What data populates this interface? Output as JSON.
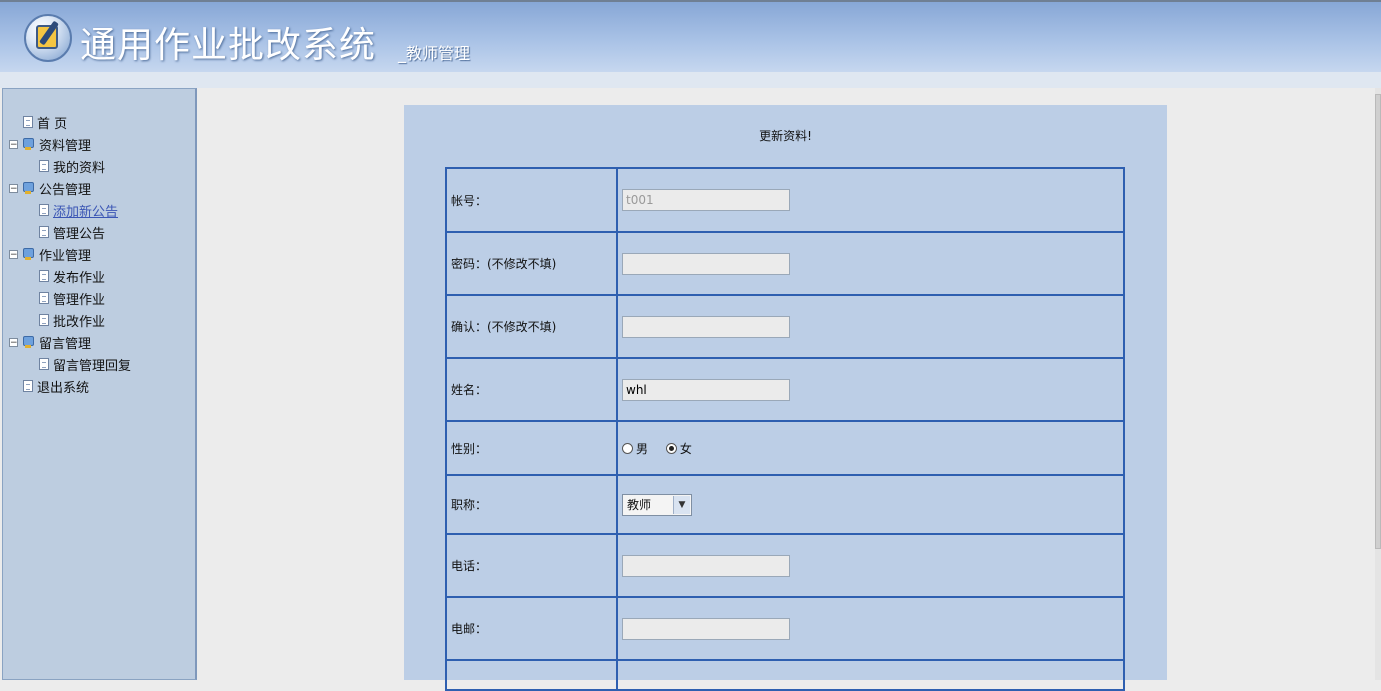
{
  "header": {
    "title": "通用作业批改系统",
    "subtitle": "_教师管理"
  },
  "sidebar": {
    "items": [
      {
        "label": "首  页",
        "level": 0,
        "icon": "page-icon"
      },
      {
        "label": "资料管理",
        "level": 1,
        "icon": "folder-icon",
        "expander": "⊟"
      },
      {
        "label": "我的资料",
        "level": 2,
        "icon": "page-icon"
      },
      {
        "label": "公告管理",
        "level": 1,
        "icon": "folder-icon",
        "expander": "⊟"
      },
      {
        "label": "添加新公告",
        "level": 2,
        "icon": "page-icon",
        "link": true
      },
      {
        "label": "管理公告",
        "level": 2,
        "icon": "page-icon"
      },
      {
        "label": "作业管理",
        "level": 1,
        "icon": "folder-icon",
        "expander": "⊟"
      },
      {
        "label": "发布作业",
        "level": 2,
        "icon": "page-icon"
      },
      {
        "label": "管理作业",
        "level": 2,
        "icon": "page-icon"
      },
      {
        "label": "批改作业",
        "level": 2,
        "icon": "page-icon"
      },
      {
        "label": "留言管理",
        "level": 1,
        "icon": "folder-icon",
        "expander": "⊟"
      },
      {
        "label": "留言管理回复",
        "level": 2,
        "icon": "page-icon"
      },
      {
        "label": "退出系统",
        "level": 0,
        "icon": "page-icon"
      }
    ]
  },
  "form": {
    "title": "更新资料!",
    "account": {
      "label": "帐号：",
      "value": "t001"
    },
    "password": {
      "label": "密码：(不修改不填)",
      "value": ""
    },
    "confirm": {
      "label": "确认：(不修改不填)",
      "value": ""
    },
    "name": {
      "label": "姓名：",
      "value": "whl"
    },
    "gender": {
      "label": "性别：",
      "options": [
        "男",
        "女"
      ],
      "selected": "女"
    },
    "title_field": {
      "label": "职称：",
      "value": "教师"
    },
    "phone": {
      "label": "电话：",
      "value": ""
    },
    "email": {
      "label": "电邮：",
      "value": ""
    }
  }
}
